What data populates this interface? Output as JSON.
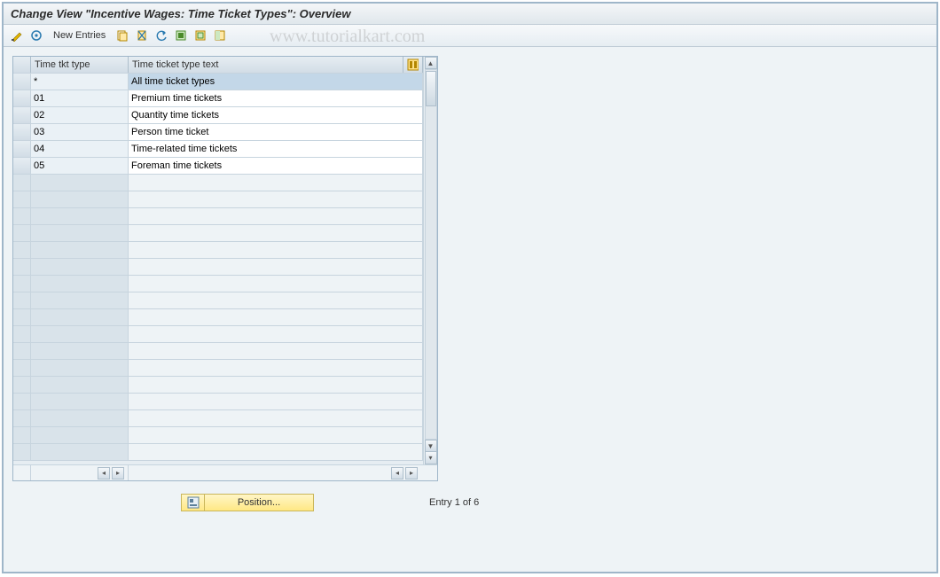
{
  "title": "Change View \"Incentive Wages: Time Ticket Types\": Overview",
  "toolbar": {
    "new_entries_label": "New Entries"
  },
  "watermark": "www.tutorialkart.com",
  "table": {
    "headers": {
      "type": "Time tkt type",
      "text": "Time ticket type text"
    },
    "rows": [
      {
        "type": "*",
        "text": "All time ticket types",
        "selected": true
      },
      {
        "type": "01",
        "text": "Premium time tickets",
        "selected": false
      },
      {
        "type": "02",
        "text": "Quantity time tickets",
        "selected": false
      },
      {
        "type": "03",
        "text": "Person time ticket",
        "selected": false
      },
      {
        "type": "04",
        "text": "Time-related time tickets",
        "selected": false
      },
      {
        "type": "05",
        "text": "Foreman time tickets",
        "selected": false
      }
    ],
    "empty_row_count": 17
  },
  "footer": {
    "position_label": "Position...",
    "entry_status": "Entry 1 of 6"
  }
}
